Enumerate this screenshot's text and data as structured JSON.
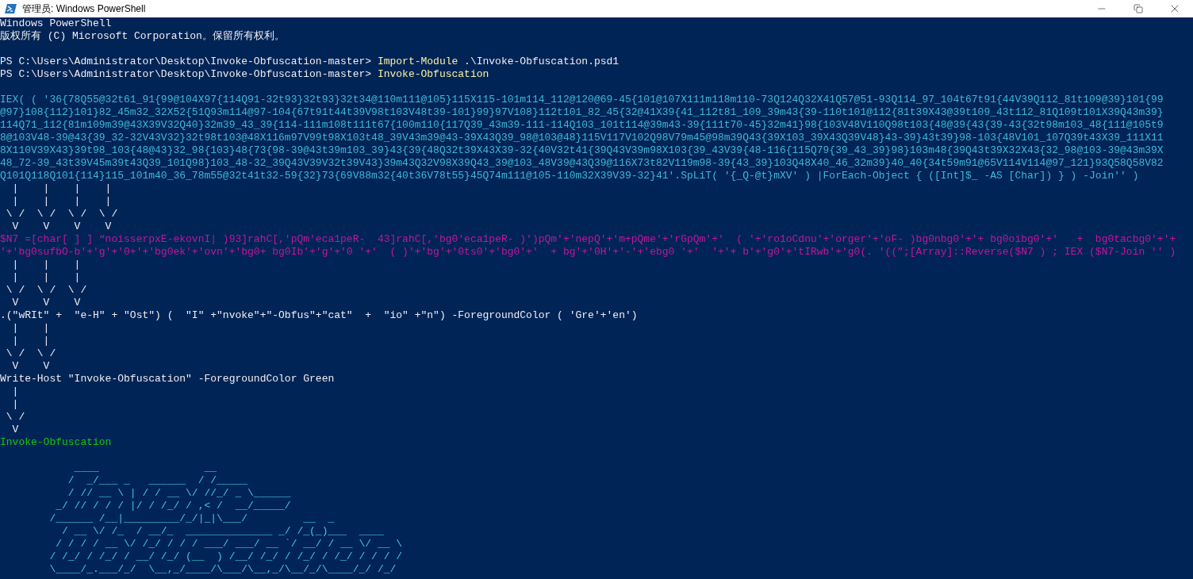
{
  "window": {
    "title": "管理员: Windows PowerShell"
  },
  "console": {
    "lines": [
      {
        "kind": "text",
        "text": "Windows PowerShell"
      },
      {
        "kind": "text",
        "text": "版权所有 (C) Microsoft Corporation。保留所有权利。"
      },
      {
        "kind": "blank"
      },
      {
        "kind": "prompt",
        "prompt": "PS C:\\Users\\Administrator\\Desktop\\Invoke-Obfuscation-master> ",
        "command": "Import-Module",
        "argument": " .\\Invoke-Obfuscation.psd1"
      },
      {
        "kind": "prompt",
        "prompt": "PS C:\\Users\\Administrator\\Desktop\\Invoke-Obfuscation-master> ",
        "command": "Invoke-Obfuscation"
      },
      {
        "kind": "blank"
      },
      {
        "kind": "cyan",
        "text": "IEX( ( '36{78Q55@32t61_91{99@104X97{114Q91-32t93}32t93}32t34@110m111@105}115X115-101m114_112@120@69-45{101@107X111m118m110-73Q124Q32X41Q57@51-93Q114_97_104t67t91{44V39Q112_81t109@39}101{99"
      },
      {
        "kind": "cyan",
        "text": "@97}108{112}101}82_45m32_32X52{51Q93m114@97-104{67t91t44t39V98t103V48t39-101}99}97V108}112t101_82_45{32@41X39{41_112t81_109_39m43{39-110t101@112{81t39X43@39t109_43t112_81Q109t101X39Q43m39}"
      },
      {
        "kind": "cyan",
        "text": "114Q71_112{81m109m39@43X39V32Q40}32m39_43_39{114-111m108t111t67{100m110{117Q39_43m39-111-114Q103_101t114@39m43-39{111t70-45}32m41}98{103V48V110Q98t103{48@39{43{39-43{32t98m103_48{111@105t9"
      },
      {
        "kind": "cyan",
        "text": "8@103V48-39@43{39_32-32V43V32}32t98t103@48X116m97V99t98X103t48_39V43m39@43-39X43Q39_98@103@48}115V117V102Q98V79m45@98m39Q43{39X103_39X43Q39V48}43-39}43t39}98-103{48V101_107Q39t43X39_111X11"
      },
      {
        "kind": "cyan",
        "text": "8X110V39X43}39t98_103{48@43}32_98{103}48{73{98-39@43t39m103_39}43{39{48Q32t39X43X39-32{40V32t41{39Q43V39m98X103{39_43V39{48-116{115Q79{39_43_39}98}103m48{39Q43t39X32X43{32_98@103-39@43m39X"
      },
      {
        "kind": "cyan",
        "text": "48_72-39_43t39V45m39t43Q39_101Q98}103_48-32_39Q43V39V32t39V43}39m43Q32V98X39Q43_39@103_48V39@43Q39@116X73t82V119m98-39{43_39}103Q48X40_46_32m39}40_40{34t59m91@65V114V114@97_121}93Q58Q58V82"
      },
      {
        "kind": "cyan",
        "text": "Q101Q118Q101{114}115_101m40_36_78m55@32t41t32-59{32}73{69V88m32{40t36V78t55}45Q74m111@105-110m32X39V39-32}41'.SpLiT( '{_Q-@t}mXV' ) |ForEach-Object { ([Int]$_ -AS [Char]) } ) -Join'' )"
      },
      {
        "kind": "arrow",
        "text": "  |    |    |    |"
      },
      {
        "kind": "arrow",
        "text": "  |    |    |    |"
      },
      {
        "kind": "arrow",
        "text": " \\ /  \\ /  \\ /  \\ /"
      },
      {
        "kind": "arrow",
        "text": "  V    V    V    V"
      },
      {
        "kind": "magenta",
        "text": "$N7 =[char[ ] ] “noisserpxE-ekovnI| )93]rahC[,'pQm'eca1peR-  43]rahC[,'bg0'eca1peR- )')pQm'+'nepQ'+'m+pQme'+'rGpQm'+'  ( '+'ro1oCdnu'+'orger'+'oF- )bg0nbg0'+'+ bg0oibg0'+'   +  bg0tacbg0'+'+"
      },
      {
        "kind": "magenta",
        "text": "'+'bg0sufbO-b'+'g'+'0+'+'bg0ek'+'ovn'+'bg0+ bg0Ib'+'g'+'0 '+'  ( )'+'bg'+'0ts0'+'bg0'+'  + bg'+'0H'+'-'+'ebg0 '+'  '+'+ b'+'g0'+'tIRwb'+'g0(. '((”;[Array]::Reverse($N7 ) ; IEX ($N7-Join '' )"
      },
      {
        "kind": "arrow",
        "text": "  |    |    |"
      },
      {
        "kind": "arrow",
        "text": "  |    |    |"
      },
      {
        "kind": "arrow",
        "text": " \\ /  \\ /  \\ /"
      },
      {
        "kind": "arrow",
        "text": "  V    V    V"
      },
      {
        "kind": "text",
        "text": ".(\"wRIt\" +  \"e-H\" + \"Ost\") (  \"I\" +\"nvoke\"+\"-Obfus\"+\"cat\"  +  \"io\" +\"n\") -ForegroundColor ( 'Gre'+'en')"
      },
      {
        "kind": "arrow",
        "text": "  |    |"
      },
      {
        "kind": "arrow",
        "text": "  |    |"
      },
      {
        "kind": "arrow",
        "text": " \\ /  \\ /"
      },
      {
        "kind": "arrow",
        "text": "  V    V"
      },
      {
        "kind": "text",
        "text": "Write-Host \"Invoke-Obfuscation\" -ForegroundColor Green"
      },
      {
        "kind": "arrow",
        "text": "  |"
      },
      {
        "kind": "arrow",
        "text": "  |"
      },
      {
        "kind": "arrow",
        "text": " \\ /"
      },
      {
        "kind": "arrow",
        "text": "  V"
      },
      {
        "kind": "green",
        "text": "Invoke-Obfuscation"
      },
      {
        "kind": "blank"
      },
      {
        "kind": "art",
        "text": "            ____                 __"
      },
      {
        "kind": "art",
        "text": "           /  _/___ _   ______  / /_____"
      },
      {
        "kind": "art",
        "text": "           / // __ \\ | / / __ \\/ //_/ _ \\______"
      },
      {
        "kind": "art",
        "text": "         _/ // / / / |/ / /_/ / ,< /  __/_____/"
      },
      {
        "kind": "art",
        "text": "        /______ /__|_________/_/|_|\\___/         __  _"
      },
      {
        "kind": "art",
        "text": "          / __ \\/ /_  / __/_  ______________ _/ /_(_)___  ____"
      },
      {
        "kind": "art",
        "text": "         / / / / __ \\/ /_/ / / / ___/ ___/ __ `/ __/ / __ \\/ __ \\"
      },
      {
        "kind": "art",
        "text": "        / /_/ / /_/ / __/ /_/ (__  ) /__/ /_/ / /_/ / /_/ / / / /"
      },
      {
        "kind": "art",
        "text": "        \\____/_.___/_/  \\__,_/____/\\___/\\__,_/\\__/_/\\____/_/ /_/"
      }
    ]
  }
}
